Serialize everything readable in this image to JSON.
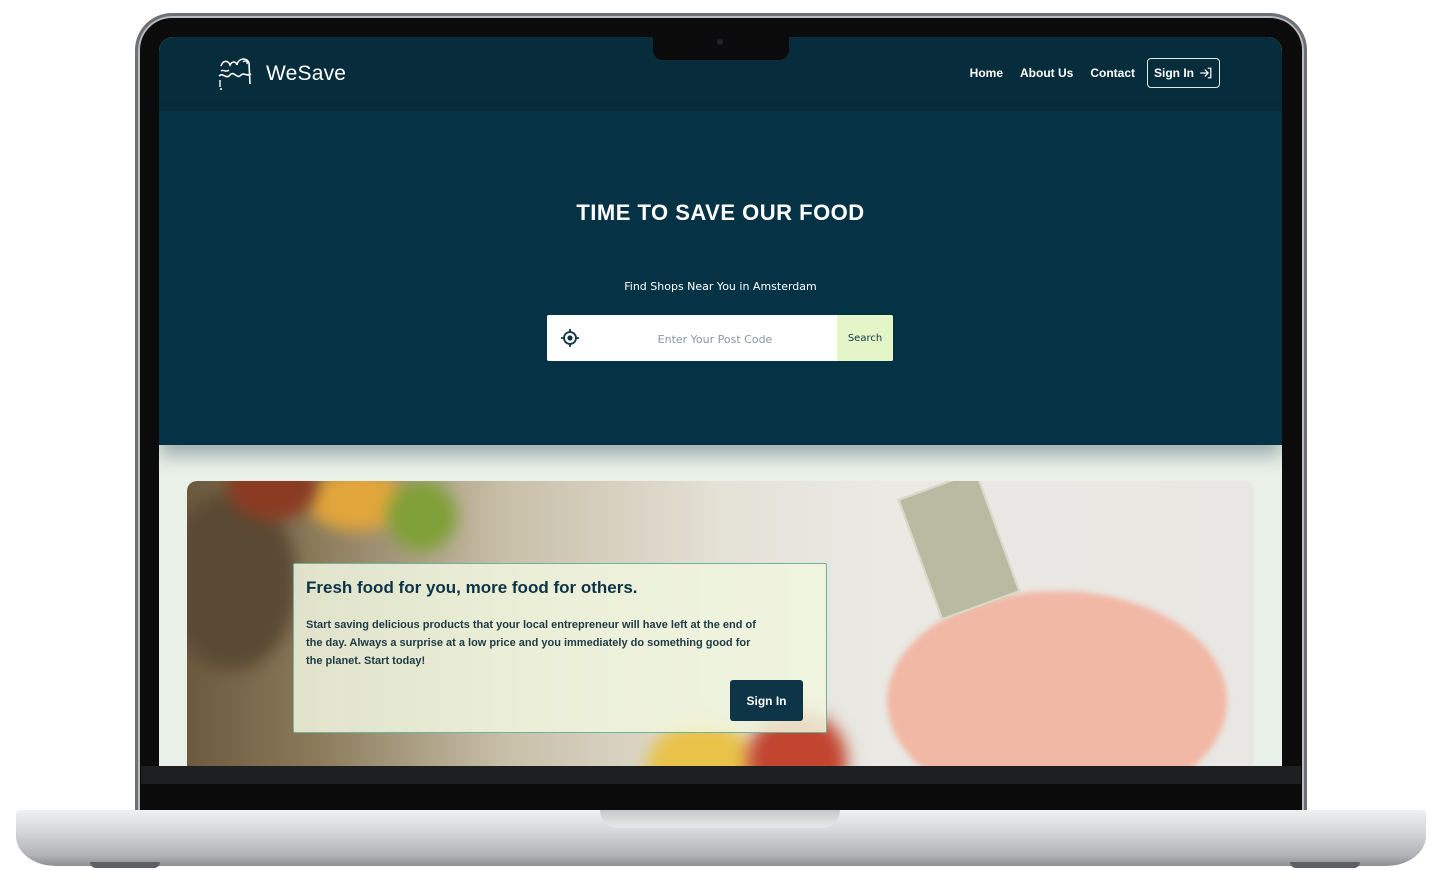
{
  "brand": {
    "name": "WeSave"
  },
  "nav": {
    "items": [
      {
        "label": "Home"
      },
      {
        "label": "About Us"
      },
      {
        "label": "Contact"
      }
    ],
    "signin_label": "Sign In"
  },
  "hero": {
    "title": "TIME TO SAVE OUR FOOD",
    "subtitle": "Find Shops Near You in Amsterdam",
    "search": {
      "placeholder": "Enter Your Post Code",
      "button_label": "Search"
    }
  },
  "promo": {
    "title": "Fresh food for you, more food for others.",
    "text": "Start saving delicious products that your local entrepreneur will have left at the end of the day. Always a surprise at a low price and you immediately do something good for the planet. Start today!",
    "button_label": "Sign In"
  },
  "colors": {
    "nav_bg": "#072d3c",
    "hero_bg": "#063245",
    "search_button_bg": "#e4f5c8",
    "card_button_bg": "#0d3547",
    "card_border": "#6fb39c"
  },
  "icons": [
    "wesave-logo-icon",
    "sign-in-arrow-icon",
    "location-crosshair-icon",
    "laptop-camera-icon"
  ]
}
